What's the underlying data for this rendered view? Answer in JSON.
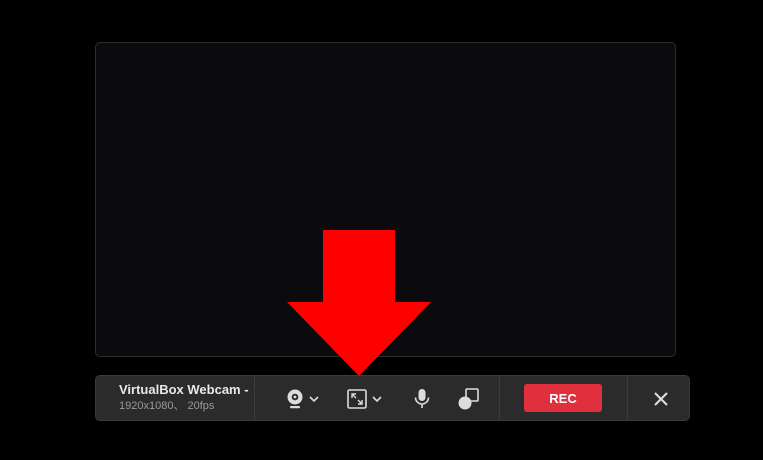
{
  "camera": {
    "device_name": "VirtualBox Webcam - ",
    "resolution": "1920x1080、 20fps"
  },
  "toolbar": {
    "rec_label": "REC",
    "icons": [
      "webcam-icon",
      "chevron-down-icon",
      "fullscreen-icon",
      "microphone-icon",
      "overlay-shapes-icon",
      "close-icon"
    ]
  },
  "colors": {
    "rec_button": "#e0303d",
    "annotation_arrow": "#ff0000",
    "toolbar_bg": "#2b2b2b"
  }
}
